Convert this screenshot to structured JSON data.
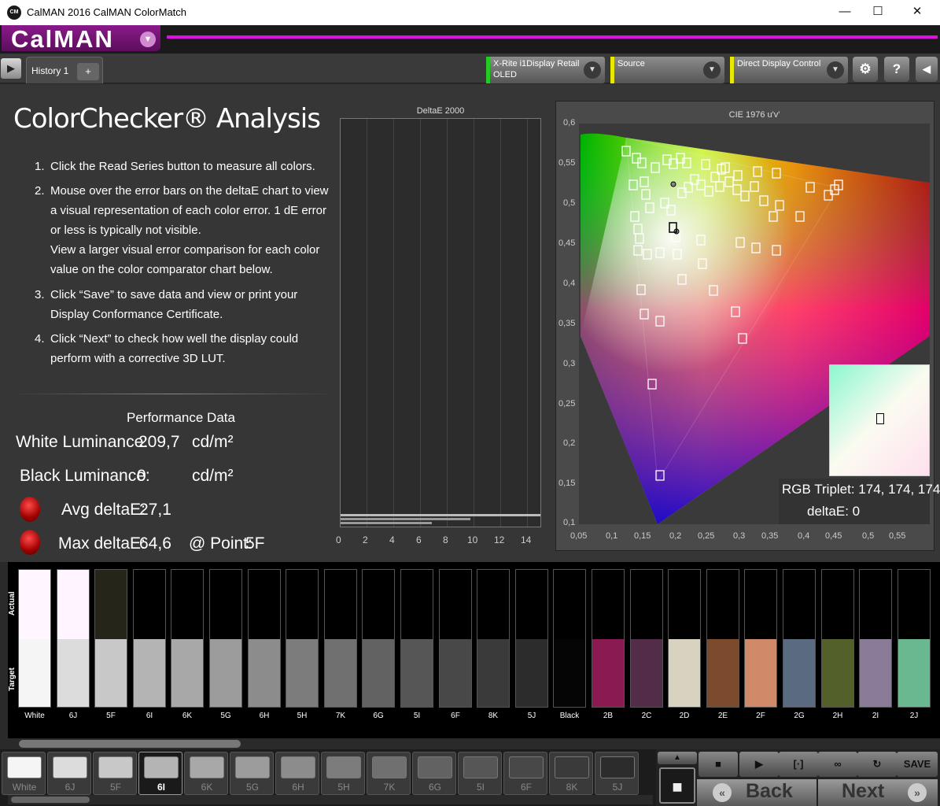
{
  "window": {
    "app_icon": "CM",
    "title": "CalMAN 2016 CalMAN ColorMatch",
    "minimize": "—",
    "maximize": "☐",
    "close": "✕"
  },
  "logo": {
    "text": "CalMAN",
    "dropdown": "▼"
  },
  "tabs": [
    {
      "label": "History 1"
    }
  ],
  "tab_add": "+",
  "toolbar": {
    "meter": {
      "line1": "X-Rite i1Display Retail",
      "line2": "OLED",
      "status_color": "#22cc22"
    },
    "source": {
      "line1": "Source",
      "line2": "",
      "status_color": "#e8e800"
    },
    "display": {
      "line1": "Direct Display Control",
      "line2": "",
      "status_color": "#e8e800"
    },
    "settings_icon": "⚙",
    "help": "?",
    "collapse": "◀",
    "play": "▶"
  },
  "page": {
    "title": "ColorChecker® Analysis",
    "instructions": [
      {
        "num": "1.",
        "text": "Click the Read Series button to measure all colors."
      },
      {
        "num": "2.",
        "text": "Mouse over the error bars on the deltaE chart to view a visual representation of each color error. 1 dE error or less is typically not visible.\nView a larger visual error comparison for each color value on the color comparator chart below."
      },
      {
        "num": "3.",
        "text": "Click “Save” to save data and view or print your Display Conformance Certificate."
      },
      {
        "num": "4.",
        "text": "Click “Next” to check how well the display could perform with a corrective 3D LUT."
      }
    ]
  },
  "performance": {
    "title": "Performance Data",
    "white_label": "White Luminance:",
    "white_value": "209,7",
    "white_unit": "cd/m²",
    "black_label": "Black Luminance:",
    "black_value": "0",
    "black_unit": "cd/m²",
    "avg_label": "Avg deltaE:",
    "avg_value": "27,1",
    "max_label": "Max deltaE:",
    "max_value": "64,6",
    "point_label": "@ Point:",
    "point_value": "5F",
    "status_color": "#cc0000"
  },
  "deltae_chart": {
    "title": "DeltaE 2000",
    "x_ticks": [
      "0",
      "2",
      "4",
      "6",
      "8",
      "10",
      "12",
      "14"
    ]
  },
  "cie_chart": {
    "title": "CIE 1976 u'v'",
    "y_ticks": [
      "0,6",
      "0,55",
      "0,5",
      "0,45",
      "0,4",
      "0,35",
      "0,3",
      "0,25",
      "0,2",
      "0,15",
      "0,1"
    ],
    "x_ticks": [
      "0,05",
      "0,1",
      "0,15",
      "0,2",
      "0,25",
      "0,3",
      "0,35",
      "0,4",
      "0,45",
      "0,5",
      "0,55"
    ],
    "rgb_triplet_label": "RGB Triplet: 174, 174, 174",
    "deltae_label": "deltaE: 0"
  },
  "comparator": {
    "actual_label": "Actual",
    "target_label": "Target",
    "swatches": [
      {
        "label": "White",
        "actual": "#fff6ff",
        "target": "#f5f5f5"
      },
      {
        "label": "6J",
        "actual": "#fff4ff",
        "target": "#dcdcdc"
      },
      {
        "label": "5F",
        "actual": "#25251a",
        "target": "#c8c8c8"
      },
      {
        "label": "6I",
        "actual": "#000000",
        "target": "#b4b4b4"
      },
      {
        "label": "6K",
        "actual": "#000000",
        "target": "#a8a8a8"
      },
      {
        "label": "5G",
        "actual": "#000000",
        "target": "#9c9c9c"
      },
      {
        "label": "6H",
        "actual": "#000000",
        "target": "#8c8c8c"
      },
      {
        "label": "5H",
        "actual": "#000000",
        "target": "#7c7c7c"
      },
      {
        "label": "7K",
        "actual": "#000000",
        "target": "#707070"
      },
      {
        "label": "6G",
        "actual": "#000000",
        "target": "#626262"
      },
      {
        "label": "5I",
        "actual": "#000000",
        "target": "#565656"
      },
      {
        "label": "6F",
        "actual": "#000000",
        "target": "#484848"
      },
      {
        "label": "8K",
        "actual": "#000000",
        "target": "#3a3a3a"
      },
      {
        "label": "5J",
        "actual": "#000000",
        "target": "#2c2c2c"
      },
      {
        "label": "Black",
        "actual": "#000000",
        "target": "#050505"
      },
      {
        "label": "2B",
        "actual": "#000000",
        "target": "#8a1a52"
      },
      {
        "label": "2C",
        "actual": "#000000",
        "target": "#522c48"
      },
      {
        "label": "2D",
        "actual": "#000000",
        "target": "#d8d2c0"
      },
      {
        "label": "2E",
        "actual": "#000000",
        "target": "#7c4a2c"
      },
      {
        "label": "2F",
        "actual": "#000000",
        "target": "#d08a6a"
      },
      {
        "label": "2G",
        "actual": "#000000",
        "target": "#5a6a80"
      },
      {
        "label": "2H",
        "actual": "#000000",
        "target": "#54602a"
      },
      {
        "label": "2I",
        "actual": "#000000",
        "target": "#8a7c98"
      },
      {
        "label": "2J",
        "actual": "#000000",
        "target": "#6ab890"
      }
    ]
  },
  "bottom_tabs": [
    {
      "label": "White",
      "color": "#f5f5f5",
      "selected": false
    },
    {
      "label": "6J",
      "color": "#dcdcdc",
      "selected": false
    },
    {
      "label": "5F",
      "color": "#c8c8c8",
      "selected": false
    },
    {
      "label": "6I",
      "color": "#b4b4b4",
      "selected": true
    },
    {
      "label": "6K",
      "color": "#a8a8a8",
      "selected": false
    },
    {
      "label": "5G",
      "color": "#9c9c9c",
      "selected": false
    },
    {
      "label": "6H",
      "color": "#8c8c8c",
      "selected": false
    },
    {
      "label": "5H",
      "color": "#7c7c7c",
      "selected": false
    },
    {
      "label": "7K",
      "color": "#707070",
      "selected": false
    },
    {
      "label": "6G",
      "color": "#626262",
      "selected": false
    },
    {
      "label": "5I",
      "color": "#565656",
      "selected": false
    },
    {
      "label": "6F",
      "color": "#484848",
      "selected": false
    },
    {
      "label": "8K",
      "color": "#3a3a3a",
      "selected": false
    },
    {
      "label": "5J",
      "color": "#2c2c2c",
      "selected": false
    }
  ],
  "controls": {
    "up": "▲",
    "stop": "■",
    "play": "▶",
    "fit": "[·]",
    "loop": "∞",
    "refresh": "↻",
    "save": "SAVE",
    "record": "■",
    "back_label": "Back",
    "back_icon": "«",
    "next_label": "Next",
    "next_icon": "»"
  }
}
